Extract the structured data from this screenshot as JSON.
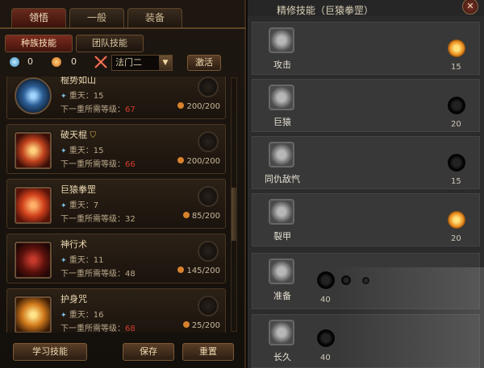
{
  "left": {
    "tabs": [
      "领悟",
      "一般",
      "装备"
    ],
    "subtabs": [
      "种族技能",
      "团队技能"
    ],
    "resources": {
      "blue_points": "0",
      "gold_points": "0"
    },
    "select": {
      "value": "法门二"
    },
    "activate_label": "激活",
    "skills": [
      {
        "name": "棍势如山",
        "level": "重天：15",
        "req_label": "下一重所需等级：",
        "req_value": "67",
        "req_met": false,
        "cost": "200/200"
      },
      {
        "name": "破天棍",
        "level": "重天：15",
        "req_label": "下一重所需等级：",
        "req_value": "66",
        "req_met": false,
        "cost": "200/200"
      },
      {
        "name": "巨猿拳罡",
        "level": "重天：7",
        "req_label": "下一重所需等级：",
        "req_value": "32",
        "req_met": true,
        "cost": "85/200"
      },
      {
        "name": "神行术",
        "level": "重天：11",
        "req_label": "下一重所需等级：",
        "req_value": "48",
        "req_met": true,
        "cost": "145/200"
      },
      {
        "name": "护身咒",
        "level": "重天：16",
        "req_label": "下一重所需等级：",
        "req_value": "68",
        "req_met": false,
        "cost": "25/200"
      }
    ],
    "buttons": {
      "learn": "学习技能",
      "save": "保存",
      "reset": "重置"
    }
  },
  "right": {
    "title": "精修技能（巨猿拳罡）",
    "rows": [
      {
        "label": "攻击",
        "value": "15",
        "active": true
      },
      {
        "label": "巨猿",
        "value": "20",
        "active": false
      },
      {
        "label": "同仇敌忾",
        "value": "15",
        "active": false
      },
      {
        "label": "裂甲",
        "value": "20",
        "active": true
      },
      {
        "label": "准备",
        "value": "40",
        "active": false
      },
      {
        "label": "长久",
        "value": "40",
        "active": false
      }
    ]
  }
}
